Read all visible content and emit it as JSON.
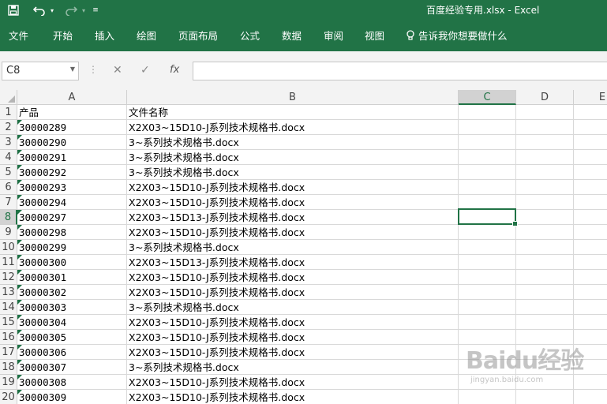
{
  "window": {
    "title": "百度经验专用.xlsx  -  Excel"
  },
  "quick_access": {
    "save_icon": "save-icon",
    "undo_icon": "undo-icon",
    "redo_icon": "redo-icon",
    "customize_icon": "customize-icon"
  },
  "ribbon": {
    "tabs": [
      "文件",
      "开始",
      "插入",
      "绘图",
      "页面布局",
      "公式",
      "数据",
      "审阅",
      "视图"
    ],
    "tell_me": "告诉我你想要做什么"
  },
  "formula_bar": {
    "name_box": "C8",
    "fx_label": "fx",
    "formula_value": ""
  },
  "sheet": {
    "columns": [
      "A",
      "B",
      "C",
      "D",
      "E"
    ],
    "selected_column": "C",
    "selected_row": "8",
    "active_cell": "C8",
    "rows": [
      {
        "num": "1",
        "a": "产品",
        "b": "文件名称"
      },
      {
        "num": "2",
        "a": "30000289",
        "b": "X2X03~15D10-J系列技术规格书.docx"
      },
      {
        "num": "3",
        "a": "30000290",
        "b": "3~系列技术规格书.docx"
      },
      {
        "num": "4",
        "a": "30000291",
        "b": "3~系列技术规格书.docx"
      },
      {
        "num": "5",
        "a": "30000292",
        "b": "3~系列技术规格书.docx"
      },
      {
        "num": "6",
        "a": "30000293",
        "b": "X2X03~15D10-J系列技术规格书.docx"
      },
      {
        "num": "7",
        "a": "30000294",
        "b": "X2X03~15D10-J系列技术规格书.docx"
      },
      {
        "num": "8",
        "a": "30000297",
        "b": "X2X03~15D13-J系列技术规格书.docx"
      },
      {
        "num": "9",
        "a": "30000298",
        "b": "X2X03~15D10-J系列技术规格书.docx"
      },
      {
        "num": "10",
        "a": "30000299",
        "b": "3~系列技术规格书.docx"
      },
      {
        "num": "11",
        "a": "30000300",
        "b": "X2X03~15D13-J系列技术规格书.docx"
      },
      {
        "num": "12",
        "a": "30000301",
        "b": "X2X03~15D10-J系列技术规格书.docx"
      },
      {
        "num": "13",
        "a": "30000302",
        "b": "X2X03~15D10-J系列技术规格书.docx"
      },
      {
        "num": "14",
        "a": "30000303",
        "b": "3~系列技术规格书.docx"
      },
      {
        "num": "15",
        "a": "30000304",
        "b": "X2X03~15D10-J系列技术规格书.docx"
      },
      {
        "num": "16",
        "a": "30000305",
        "b": "X2X03~15D10-J系列技术规格书.docx"
      },
      {
        "num": "17",
        "a": "30000306",
        "b": "X2X03~15D10-J系列技术规格书.docx"
      },
      {
        "num": "18",
        "a": "30000307",
        "b": "3~系列技术规格书.docx"
      },
      {
        "num": "19",
        "a": "30000308",
        "b": "X2X03~15D10-J系列技术规格书.docx"
      },
      {
        "num": "20",
        "a": "30000309",
        "b": "X2X03~15D10-J系列技术规格书.docx"
      }
    ]
  },
  "watermark": {
    "brand": "Baidu经验",
    "url": "jingyan.baidu.com"
  },
  "colors": {
    "excel_green": "#217346",
    "gridline": "#d9d9d9",
    "header_bg": "#f3f3f3"
  }
}
